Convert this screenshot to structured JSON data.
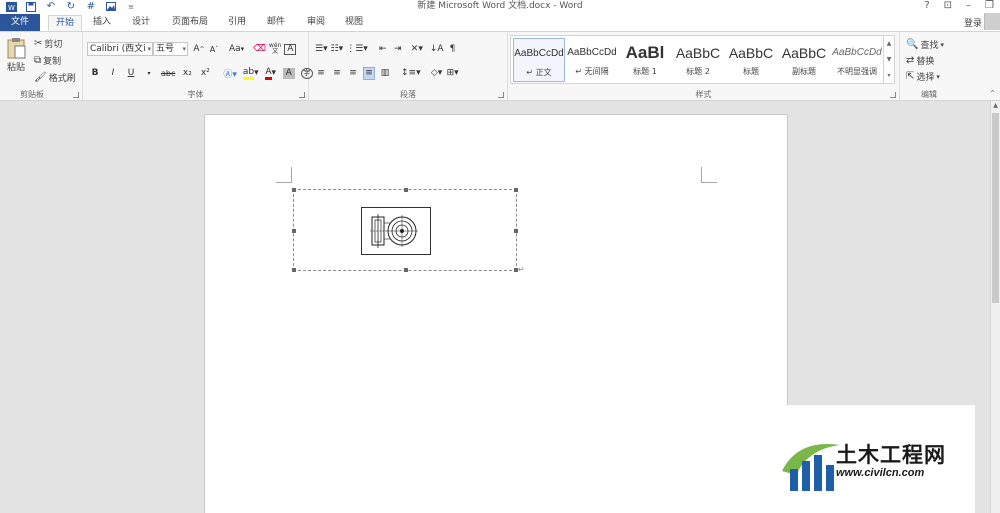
{
  "window": {
    "title": "新建 Microsoft Word 文档.docx - Word",
    "controls": [
      "?",
      "⊡",
      "–",
      "❐"
    ]
  },
  "tabs": {
    "file": "文件",
    "items": [
      "开始",
      "插入",
      "设计",
      "页面布局",
      "引用",
      "邮件",
      "审阅",
      "视图"
    ],
    "active": "开始",
    "signin": "登录"
  },
  "clipboard": {
    "paste": "粘贴",
    "cut": "剪切",
    "copy": "复制",
    "format_painter": "格式刷",
    "label": "剪贴板"
  },
  "font": {
    "name": "Calibri (西文i",
    "size": "五号",
    "aa": "Aa",
    "label": "字体",
    "bold": "B",
    "italic": "I",
    "underline": "U",
    "strike": "abc",
    "sub": "x₂",
    "sup": "x²",
    "grow": "A",
    "shrink": "A",
    "phonetic": "wén",
    "border": "A",
    "highlight_color": "#ffff00",
    "font_color": "#e00000"
  },
  "paragraph": {
    "label": "段落"
  },
  "styles": {
    "label": "样式",
    "items": [
      {
        "sample": "AaBbCcDd",
        "name": "正文"
      },
      {
        "sample": "AaBbCcDd",
        "name": "无间隔"
      },
      {
        "sample": "AaBl",
        "name": "标题 1"
      },
      {
        "sample": "AaBbC",
        "name": "标题 2"
      },
      {
        "sample": "AaBbC",
        "name": "标题"
      },
      {
        "sample": "AaBbC",
        "name": "副标题"
      },
      {
        "sample": "AaBbCcDd",
        "name": "不明显强调"
      }
    ]
  },
  "editing": {
    "label": "编辑",
    "find": "查找",
    "replace": "替换",
    "select": "选择"
  },
  "document": {
    "para_mark": "↵"
  },
  "watermark": {
    "title": "土木工程网",
    "url": "www.civilcn.com"
  },
  "colors": {
    "accent": "#2b579a"
  }
}
